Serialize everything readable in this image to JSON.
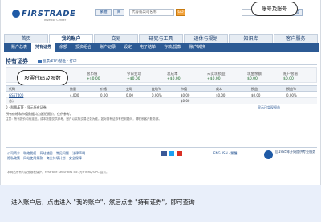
{
  "header": {
    "logo_text": "FIRSTRADE",
    "logo_sub": "Investor Center",
    "lang_primary": "繁體",
    "lang_secondary": "简",
    "quote_placeholder": "代号或公司名称",
    "go_label": "GO",
    "account_number": "",
    "logout_label": "登出"
  },
  "callouts": {
    "top_right": "账号及账号",
    "left": "股票代码及股数"
  },
  "main_nav": [
    {
      "label": "首页"
    },
    {
      "label": "我的账户"
    },
    {
      "label": "交易"
    },
    {
      "label": "研究与工具"
    },
    {
      "label": "退休与规划"
    },
    {
      "label": "知识库"
    },
    {
      "label": "客户服务"
    }
  ],
  "sub_nav": [
    {
      "label": "账户总表"
    },
    {
      "label": "持有证券"
    },
    {
      "label": "余额"
    },
    {
      "label": "投资组合"
    },
    {
      "label": "账户记录"
    },
    {
      "label": "设定"
    },
    {
      "label": "电子结单"
    },
    {
      "label": "存款/提款"
    },
    {
      "label": "账户转换"
    }
  ],
  "page": {
    "title": "持有证券",
    "links": "股票/ETF/基金 · 打印",
    "sort_link": "显示全部"
  },
  "summary": {
    "labels": [
      "总市值",
      "今日变动",
      "总成本",
      "未实现损益",
      "现金余额",
      "账户总值"
    ],
    "values": [
      "+$0.00",
      "+$0.00",
      "+$0.00",
      "+$0.00",
      "$0.00",
      "$0.00"
    ]
  },
  "table": {
    "headers": [
      "代码",
      "数量",
      "价格",
      "变动",
      "变动%",
      "市值",
      "成本",
      "损益",
      "损益%"
    ],
    "rows": [
      {
        "symbol": "GS57400",
        "qty": "4,000",
        "price": "0.00",
        "chg": "0.00",
        "chgpct": "0.00%",
        "mv": "$0.00",
        "cost": "$0.00",
        "pl": "$0.00",
        "plpct": "0.00%"
      }
    ],
    "total_label": "总计",
    "total_value": "$0.00"
  },
  "table_foot_left": "0 · 股票/ETF · 显示所有证券",
  "table_foot_right": "显示已实现损益",
  "note_line": "所有价格和市值数据均为延迟报价，仅供参考。",
  "disclaimer": "注意：所有报价均有延迟。成本数据仅供参考，账户以实际交易记录为准。如对持有证券有任何疑问，请联系客户服务部。",
  "footer": {
    "links": [
      "公司简介",
      "联络我们",
      "网站地图",
      "常见问题",
      "法律声明",
      "隐私政策",
      "网站使用条款",
      "商业持续计划",
      "安全保障"
    ],
    "lang": "ENGLISH · 繁體",
    "since": "自1985年开始提供专业服务",
    "copyright": "本网站所有内容受版权保护。Firstrade Securities Inc. 为 FINRA/SIPC 会员。"
  },
  "instruction": {
    "text": "进入账户后，点击进入 \"我的账户\"，然后点击 \"持有证券\"，即可查询"
  },
  "colors": {
    "brand_blue": "#1f4f8f",
    "subnav_bg": "#2c5a94",
    "go_orange": "#f2a23a",
    "panel_bg": "#e9effa"
  }
}
